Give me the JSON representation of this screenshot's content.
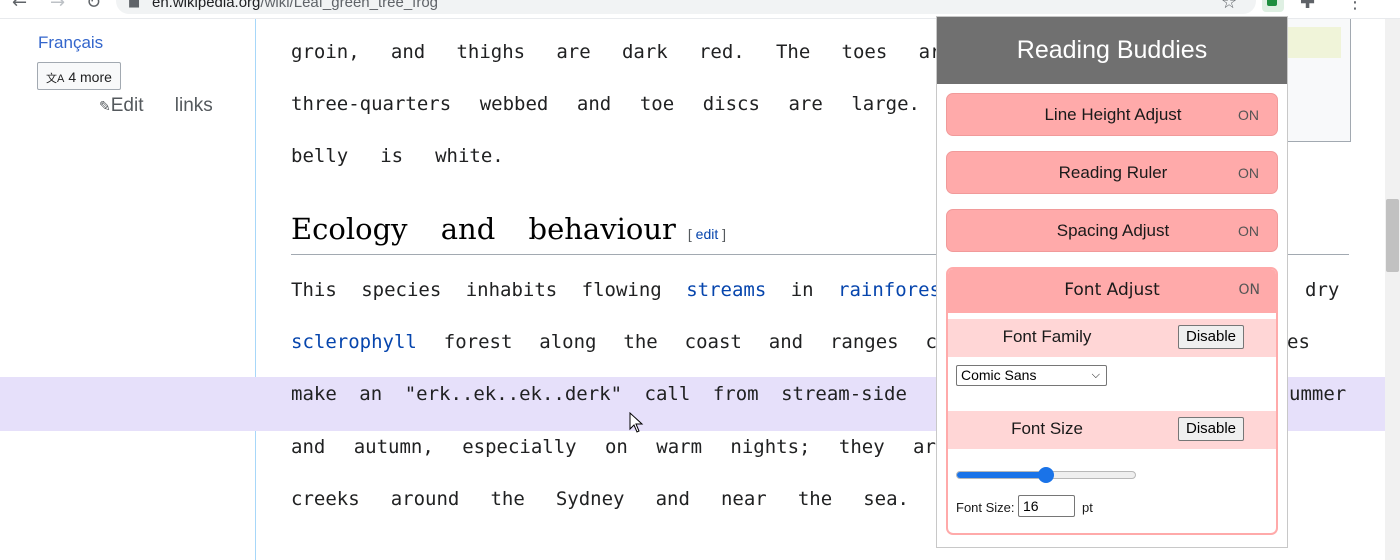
{
  "browser": {
    "url_host": "en.wikipedia.org",
    "url_path": "/wiki/Leaf_green_tree_frog",
    "icons": [
      "back-icon",
      "forward-icon",
      "reload-icon",
      "lock-icon",
      "star-icon",
      "extension-icon",
      "puzzle-icon",
      "menu-icon"
    ]
  },
  "sidebar": {
    "language": "Français",
    "more_languages": "4 more",
    "edit_links": "Edit links"
  },
  "article": {
    "lines_top": [
      [
        "groin,",
        "and",
        "thighs",
        "are",
        "dark",
        "red.",
        "The",
        "toes",
        "are"
      ],
      [
        "three-quarters",
        "webbed",
        "and",
        "toe",
        "discs",
        "are",
        "large."
      ],
      [
        "belly",
        "is",
        "white."
      ]
    ],
    "section_heading": "Ecology and behaviour",
    "section_edit": "edit",
    "body_line_1": [
      "This",
      "species",
      "inhabits",
      "flowing",
      "streams",
      "in",
      "rainfores"
    ],
    "body_line_1_end": "dry",
    "body_line_1_links": [
      "streams",
      "rainfores"
    ],
    "body_line_2": [
      "sclerophyll",
      "forest",
      "along",
      "the",
      "coast",
      "and",
      "ranges",
      "c"
    ],
    "body_line_2_end": "es",
    "body_line_3": [
      "make",
      "an",
      "\"erk..ek..ek..derk\"",
      "call",
      "from",
      "stream-side"
    ],
    "body_line_3_end": "ummer",
    "body_line_4": [
      "and",
      "autumn,",
      "especially",
      "on",
      "warm",
      "nights;",
      "they",
      "ar"
    ],
    "body_line_5": [
      "creeks",
      "around",
      "the",
      "Sydney",
      "and",
      "near",
      "the",
      "sea."
    ]
  },
  "extension": {
    "title": "Reading Buddies",
    "features": [
      {
        "label": "Line Height Adjust",
        "state": "ON"
      },
      {
        "label": "Reading Ruler",
        "state": "ON"
      },
      {
        "label": "Spacing Adjust",
        "state": "ON"
      },
      {
        "label": "Font Adjust",
        "state": "ON"
      }
    ],
    "font_family_label": "Font Family",
    "font_family_disable": "Disable",
    "font_family_value": "Comic Sans",
    "font_size_label": "Font Size",
    "font_size_disable": "Disable",
    "font_size_slider_fraction": 0.5,
    "font_size_field_label": "Font Size:",
    "font_size_value": "16",
    "font_size_unit": "pt"
  }
}
